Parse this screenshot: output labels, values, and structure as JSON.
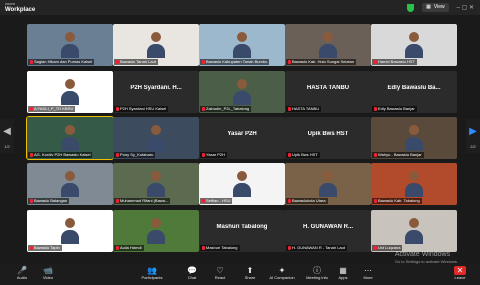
{
  "app": {
    "brand_small": "zoom",
    "brand_name": "Workplace",
    "view_label": "View",
    "view_icon": "grid-icon",
    "window_controls": "–  ▢  ✕"
  },
  "grid": {
    "page_left": "1/2",
    "page_right": "2/2",
    "tiles": [
      {
        "name": "Sagian Hikam dan Pumas Kalsel",
        "type": "video",
        "bg": "#6a7e94"
      },
      {
        "name": "Bawaslu Tanah Laut",
        "type": "video",
        "bg": "#e9e6e2"
      },
      {
        "name": "Bawaslu Kabupaten Tanah Bumbu",
        "type": "video",
        "bg": "#9cb8cc"
      },
      {
        "name": "Bawaslu Kab. Hulu Sungai Selatan",
        "type": "video",
        "bg": "#6b6058"
      },
      {
        "name": "Hamid Bawaslu HST",
        "type": "video",
        "bg": "#d9d9d9"
      },
      {
        "name": "A FADLI_P_TD KBRU",
        "type": "video",
        "bg": "#ffffff"
      },
      {
        "name": "P2H Syardani HSU Kalsel",
        "type": "name",
        "bigname": "P2H Syardani. H..."
      },
      {
        "name": "Zainudin_P2L_Tabalong",
        "type": "video",
        "bg": "#4b5f48"
      },
      {
        "name": "HASTA TANBU",
        "type": "name",
        "bigname": "HASTA TANBU"
      },
      {
        "name": "Edly Bawaslu Banjar",
        "type": "name",
        "bigname": "Edly Bawaslu Ba..."
      },
      {
        "name": "AG. Kordiv P2H Bawaslu Kalsel",
        "type": "video",
        "bg": "#355a48",
        "active": true
      },
      {
        "name": "Pony Sy_Kotabaru",
        "type": "video",
        "bg": "#3c4c5e"
      },
      {
        "name": "Yasar P2H",
        "type": "name",
        "bigname": "Yasar P2H"
      },
      {
        "name": "Upik Bws HST",
        "type": "name",
        "bigname": "Upik Bws HST"
      },
      {
        "name": "Wahyu - Bawaslu Banjar",
        "type": "video",
        "bg": "#5a4a3c"
      },
      {
        "name": "Bawaslu Balangan",
        "type": "video",
        "bg": "#7f8a94"
      },
      {
        "name": "Muhammad Rifani (Bawa...",
        "type": "video",
        "bg": "#5c6a50"
      },
      {
        "name": "Seftian - HSU",
        "type": "video",
        "bg": "#f4f4f4"
      },
      {
        "name": "Bawaslukota Utara",
        "type": "video",
        "bg": "#7a6248"
      },
      {
        "name": "Bawaslu Kab. Tabalong",
        "type": "video",
        "bg": "#b24a2c"
      },
      {
        "name": "Bawaslu Tapin",
        "type": "video",
        "bg": "#ffffff"
      },
      {
        "name": "Aulia Hamdi",
        "type": "video",
        "bg": "#4f7a3a"
      },
      {
        "name": "Mashuri Tabalong",
        "type": "name",
        "bigname": "Mashuri Tabalong"
      },
      {
        "name": "H. GUNAWAN R - Tanah Laut",
        "type": "name",
        "bigname": "H. GUNAWAN R..."
      },
      {
        "name": "Ust Luqzana",
        "type": "video",
        "bg": "#c9c3bd"
      }
    ]
  },
  "toolbar": {
    "items": [
      {
        "key": "audio",
        "label": "Audio",
        "icon": "🎤",
        "muted": true
      },
      {
        "key": "video",
        "label": "Video",
        "icon": "📹",
        "muted": true
      },
      {
        "key": "participants",
        "label": "Participants",
        "icon": "👥"
      },
      {
        "key": "chat",
        "label": "Chat",
        "icon": "💬"
      },
      {
        "key": "react",
        "label": "React",
        "icon": "♡"
      },
      {
        "key": "share",
        "label": "Share",
        "icon": "⬆"
      },
      {
        "key": "ai_companion",
        "label": "AI Companion",
        "icon": "✦"
      },
      {
        "key": "meeting_info",
        "label": "Meeting info",
        "icon": "ⓘ"
      },
      {
        "key": "apps",
        "label": "Apps",
        "icon": "▦"
      },
      {
        "key": "more",
        "label": "More",
        "icon": "⋯"
      },
      {
        "key": "leave",
        "label": "Leave",
        "icon": "✕"
      }
    ]
  },
  "watermark": {
    "title": "Activate Windows",
    "subtitle": "Go to Settings to activate Windows."
  }
}
